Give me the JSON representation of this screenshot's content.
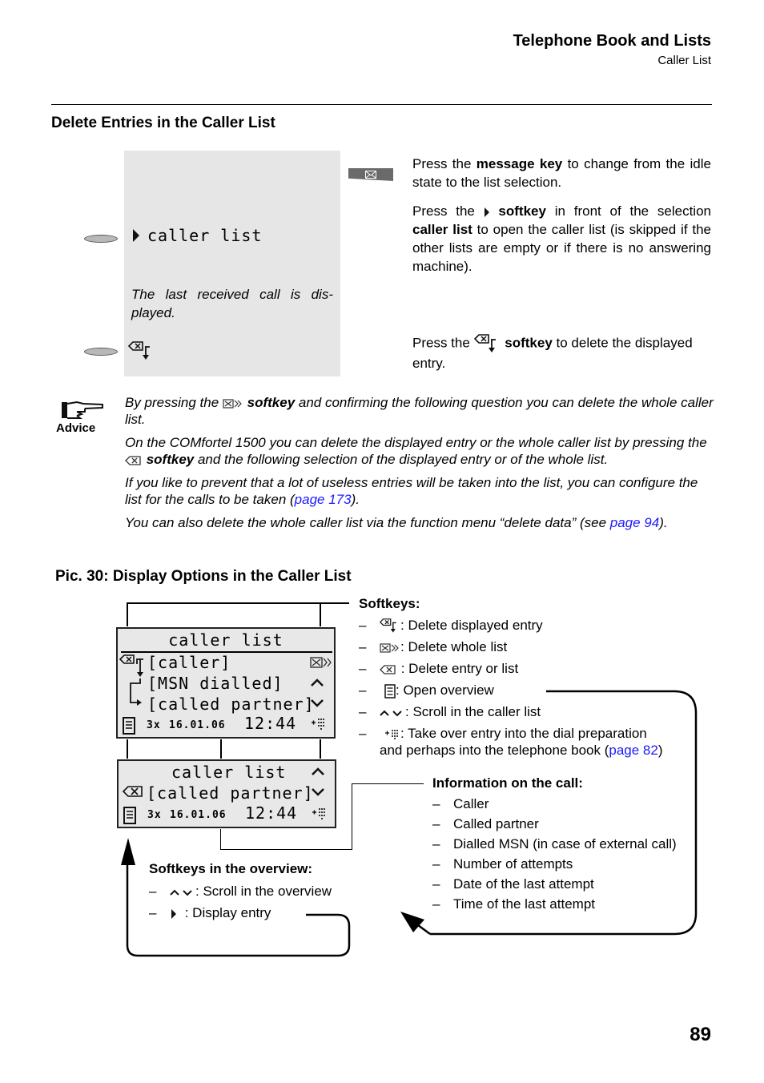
{
  "header": {
    "title": "Telephone Book and Lists",
    "subtitle": "Caller List"
  },
  "section": {
    "title": "Delete Entries in the Caller List"
  },
  "display_panel": {
    "menu_item": "caller list",
    "note": "The last received call is dis-played.",
    "icons": [
      "message-key-icon",
      "play-arrow-icon",
      "delete-displayed-entry-icon"
    ]
  },
  "steps": [
    {
      "parts": [
        {
          "text": "Press the ",
          "bold": false
        },
        {
          "text": "message key",
          "bold": true
        },
        {
          "text": " to change from the idle state to the list selection.",
          "bold": false
        }
      ]
    },
    {
      "parts": [
        {
          "text": "Press the ",
          "bold": false
        },
        {
          "icon": "play-arrow-icon"
        },
        {
          "text": " softkey",
          "bold": true
        },
        {
          "text": " in front of the selection ",
          "bold": false
        },
        {
          "text": "caller list",
          "bold": true
        },
        {
          "text": " to open the caller list (is skipped if the other lists are empty or if there is no answering machine).",
          "bold": false
        }
      ]
    },
    {
      "parts": [
        {
          "text": "Press the ",
          "bold": false
        },
        {
          "icon": "delete-displayed-entry-icon"
        },
        {
          "text": " softkey",
          "bold": true
        },
        {
          "text": " to delete the displayed entry.",
          "bold": false
        }
      ]
    }
  ],
  "advice": {
    "label": "Advice",
    "paragraphs": [
      {
        "pre": "By pressing the ",
        "icon": "delete-whole-list-icon",
        "bold": " softkey",
        "post": " and confirming the following question you can delete the whole caller list."
      },
      {
        "pre": "On the COMfortel 1500 you can delete the displayed entry or the whole caller list by pressing the ",
        "icon": "delete-icon",
        "bold": " softkey",
        "post": " and the following selection of the displayed entry or of the whole list."
      },
      {
        "pre": "If you like to prevent that a lot of useless entries will be taken into the list, you can configure the list for the calls to be taken (",
        "link": "page 173",
        "post": ")."
      },
      {
        "pre": "You can also delete the whole caller list via the function menu “delete data” (see ",
        "link": "page 94",
        "post": ")."
      }
    ]
  },
  "figure": {
    "title": "Pic. 30: Display Options in the Caller List",
    "lcd_main": {
      "header": "caller list",
      "rows": [
        "[caller]",
        "[MSN dialled]",
        "[called partner]"
      ],
      "footer": {
        "attempts": "3x",
        "date": "16.01.06",
        "time": "12:44"
      }
    },
    "lcd_overview": {
      "header": "caller list",
      "row": "[called partner]",
      "footer": {
        "attempts": "3x",
        "date": "16.01.06",
        "time": "12:44"
      }
    },
    "softkeys": {
      "title": "Softkeys:",
      "items": [
        {
          "icon": "delete-displayed-entry-icon",
          "text": ": Delete displayed entry"
        },
        {
          "icon": "delete-whole-list-icon",
          "text": ": Delete whole list"
        },
        {
          "icon": "delete-icon",
          "text": " : Delete entry or list"
        },
        {
          "icon": "overview-icon",
          "text": ": Open overview"
        },
        {
          "icon": "scroll-up-down-icon",
          "text": ": Scroll in the caller list"
        },
        {
          "icon": "dial-preparation-icon",
          "text": ": Take over entry into the dial preparation"
        }
      ],
      "continuation": "and perhaps into the telephone book (",
      "continuation_link": "page 82",
      "continuation_end": ")"
    },
    "information": {
      "title": "Information on the call:",
      "items": [
        "Caller",
        "Called partner",
        "Dialled MSN (in case of external call)",
        "Number of attempts",
        "Date of the last attempt",
        "Time of the last attempt"
      ]
    },
    "overview_softkeys": {
      "title": "Softkeys in the overview:",
      "items": [
        {
          "icon": "scroll-up-down-icon",
          "text": ": Scroll in the overview"
        },
        {
          "icon": "play-arrow-icon",
          "text": " : Display entry"
        }
      ]
    }
  },
  "page_number": "89"
}
